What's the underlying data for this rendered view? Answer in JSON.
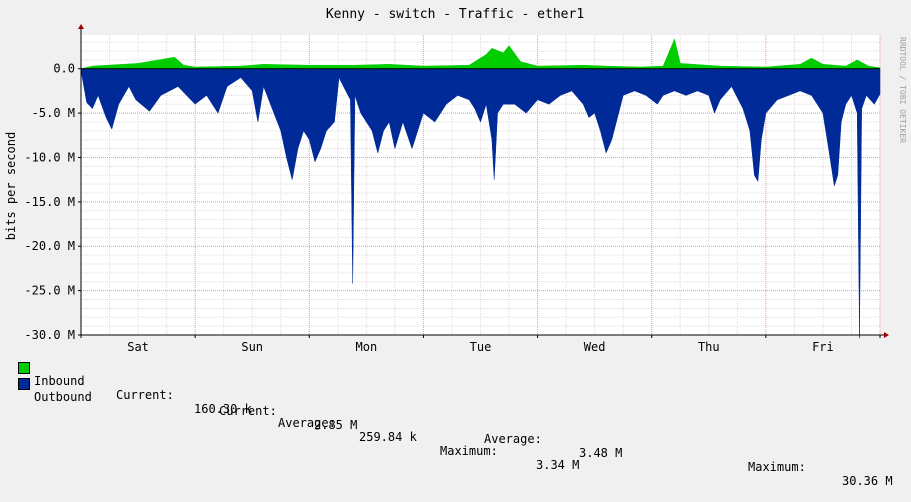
{
  "chart_data": {
    "type": "area",
    "title": "Kenny - switch - Traffic - ether1",
    "ylabel": "bits per second",
    "watermark": "RRDTOOL / TOBI OETIKER",
    "ylim": [
      -30000000,
      3800000
    ],
    "yticks": [
      {
        "value": 0,
        "label": "0.0"
      },
      {
        "value": -5000000,
        "label": "-5.0 M"
      },
      {
        "value": -10000000,
        "label": "-10.0 M"
      },
      {
        "value": -15000000,
        "label": "-15.0 M"
      },
      {
        "value": -20000000,
        "label": "-20.0 M"
      },
      {
        "value": -25000000,
        "label": "-25.0 M"
      },
      {
        "value": -30000000,
        "label": "-30.0 M"
      }
    ],
    "xlim_days": [
      0,
      7
    ],
    "xticks": [
      {
        "day": 0.5,
        "label": "Sat"
      },
      {
        "day": 1.5,
        "label": "Sun"
      },
      {
        "day": 2.5,
        "label": "Mon"
      },
      {
        "day": 3.5,
        "label": "Tue"
      },
      {
        "day": 4.5,
        "label": "Wed"
      },
      {
        "day": 5.5,
        "label": "Thu"
      },
      {
        "day": 6.5,
        "label": "Fri"
      }
    ],
    "grid": true,
    "legend_position": "bottom",
    "series": [
      {
        "name": "Inbound",
        "color": "#00cc00",
        "stats": {
          "current": "160.30 k",
          "average": "259.84 k",
          "maximum": "3.34 M"
        },
        "points": [
          [
            0.0,
            0.0
          ],
          [
            0.1,
            0.3
          ],
          [
            0.5,
            0.6
          ],
          [
            0.82,
            1.3
          ],
          [
            0.9,
            0.4
          ],
          [
            1.0,
            0.2
          ],
          [
            1.4,
            0.3
          ],
          [
            1.6,
            0.5
          ],
          [
            2.0,
            0.4
          ],
          [
            2.4,
            0.4
          ],
          [
            2.7,
            0.5
          ],
          [
            3.0,
            0.3
          ],
          [
            3.4,
            0.4
          ],
          [
            3.55,
            1.6
          ],
          [
            3.6,
            2.3
          ],
          [
            3.7,
            1.8
          ],
          [
            3.75,
            2.6
          ],
          [
            3.85,
            0.8
          ],
          [
            4.0,
            0.3
          ],
          [
            4.4,
            0.4
          ],
          [
            4.6,
            0.3
          ],
          [
            4.9,
            0.2
          ],
          [
            5.1,
            0.3
          ],
          [
            5.2,
            3.34
          ],
          [
            5.25,
            0.6
          ],
          [
            5.6,
            0.3
          ],
          [
            6.0,
            0.2
          ],
          [
            6.3,
            0.5
          ],
          [
            6.4,
            1.2
          ],
          [
            6.5,
            0.5
          ],
          [
            6.7,
            0.3
          ],
          [
            6.8,
            1.0
          ],
          [
            6.9,
            0.3
          ],
          [
            7.0,
            0.1
          ]
        ]
      },
      {
        "name": "Outbound",
        "color": "#002a97",
        "stats": {
          "current": "2.85 M",
          "average": "3.48 M",
          "maximum": "30.36 M"
        },
        "points": [
          [
            0.0,
            0.2
          ],
          [
            0.05,
            3.8
          ],
          [
            0.1,
            4.5
          ],
          [
            0.15,
            3.0
          ],
          [
            0.22,
            5.5
          ],
          [
            0.27,
            6.8
          ],
          [
            0.33,
            4.0
          ],
          [
            0.42,
            2.0
          ],
          [
            0.48,
            3.5
          ],
          [
            0.6,
            4.8
          ],
          [
            0.7,
            3.0
          ],
          [
            0.85,
            2.0
          ],
          [
            1.0,
            4.0
          ],
          [
            1.1,
            3.0
          ],
          [
            1.2,
            5.0
          ],
          [
            1.28,
            2.0
          ],
          [
            1.4,
            1.0
          ],
          [
            1.5,
            2.5
          ],
          [
            1.55,
            6.0
          ],
          [
            1.6,
            2.0
          ],
          [
            1.75,
            7.0
          ],
          [
            1.8,
            10.0
          ],
          [
            1.85,
            12.5
          ],
          [
            1.9,
            9.0
          ],
          [
            1.95,
            7.0
          ],
          [
            2.0,
            8.0
          ],
          [
            2.05,
            10.5
          ],
          [
            2.1,
            9.0
          ],
          [
            2.15,
            7.0
          ],
          [
            2.22,
            6.0
          ],
          [
            2.26,
            1.0
          ],
          [
            2.3,
            2.0
          ],
          [
            2.36,
            3.5
          ],
          [
            2.38,
            24.2
          ],
          [
            2.4,
            3.0
          ],
          [
            2.45,
            5.0
          ],
          [
            2.5,
            6.0
          ],
          [
            2.55,
            7.0
          ],
          [
            2.6,
            9.5
          ],
          [
            2.65,
            7.0
          ],
          [
            2.7,
            6.0
          ],
          [
            2.75,
            9.0
          ],
          [
            2.82,
            6.0
          ],
          [
            2.9,
            9.0
          ],
          [
            3.0,
            5.0
          ],
          [
            3.1,
            6.0
          ],
          [
            3.2,
            4.0
          ],
          [
            3.3,
            3.0
          ],
          [
            3.4,
            3.5
          ],
          [
            3.45,
            4.5
          ],
          [
            3.5,
            6.0
          ],
          [
            3.55,
            4.0
          ],
          [
            3.6,
            8.0
          ],
          [
            3.62,
            12.5
          ],
          [
            3.65,
            5.0
          ],
          [
            3.7,
            4.0
          ],
          [
            3.8,
            4.0
          ],
          [
            3.9,
            5.0
          ],
          [
            4.0,
            3.5
          ],
          [
            4.1,
            4.0
          ],
          [
            4.2,
            3.0
          ],
          [
            4.3,
            2.5
          ],
          [
            4.4,
            4.0
          ],
          [
            4.45,
            5.5
          ],
          [
            4.5,
            5.0
          ],
          [
            4.55,
            7.0
          ],
          [
            4.6,
            9.5
          ],
          [
            4.65,
            8.0
          ],
          [
            4.75,
            3.0
          ],
          [
            4.85,
            2.5
          ],
          [
            4.95,
            3.0
          ],
          [
            5.05,
            4.0
          ],
          [
            5.1,
            3.0
          ],
          [
            5.2,
            2.5
          ],
          [
            5.3,
            3.0
          ],
          [
            5.4,
            2.5
          ],
          [
            5.5,
            3.0
          ],
          [
            5.55,
            5.0
          ],
          [
            5.6,
            3.5
          ],
          [
            5.7,
            2.0
          ],
          [
            5.8,
            4.5
          ],
          [
            5.86,
            7.0
          ],
          [
            5.9,
            12.0
          ],
          [
            5.93,
            12.7
          ],
          [
            5.96,
            8.0
          ],
          [
            6.0,
            5.0
          ],
          [
            6.1,
            3.5
          ],
          [
            6.2,
            3.0
          ],
          [
            6.3,
            2.5
          ],
          [
            6.4,
            3.0
          ],
          [
            6.5,
            5.0
          ],
          [
            6.55,
            9.0
          ],
          [
            6.6,
            13.2
          ],
          [
            6.63,
            12.0
          ],
          [
            6.66,
            6.0
          ],
          [
            6.7,
            4.0
          ],
          [
            6.75,
            3.0
          ],
          [
            6.8,
            5.0
          ],
          [
            6.82,
            30.36
          ],
          [
            6.84,
            4.5
          ],
          [
            6.88,
            3.0
          ],
          [
            6.95,
            4.0
          ],
          [
            7.0,
            2.85
          ]
        ]
      }
    ]
  },
  "legend": {
    "current_label": "Current:",
    "average_label": "Average:",
    "maximum_label": "Maximum:"
  }
}
